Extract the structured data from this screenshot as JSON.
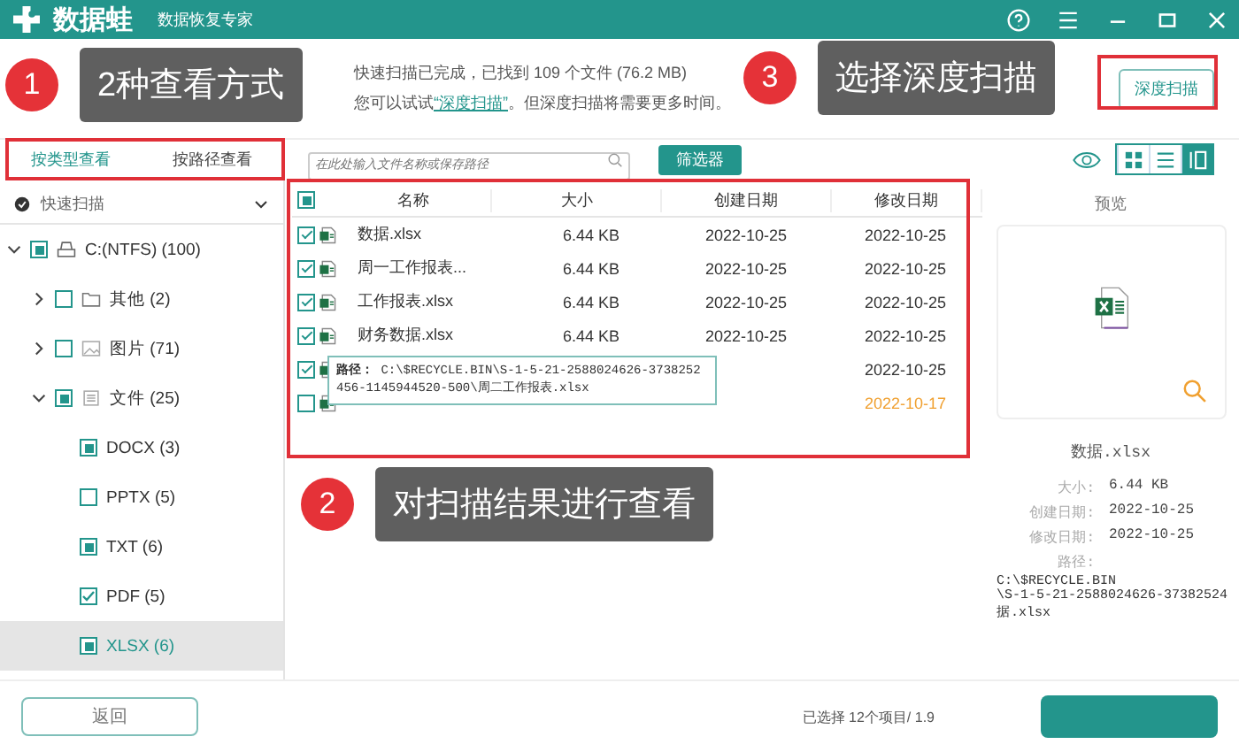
{
  "app": {
    "name": "数据蛙",
    "subtitle": "数据恢复专家"
  },
  "scan_info": {
    "line1": "快速扫描已完成，已找到 109 个文件 (76.2 MB)",
    "line2_before": "您可以试试",
    "link": "“深度扫描”",
    "line2_after": "。但深度扫描将需要更多时间。"
  },
  "deep_scan_button": "深度扫描",
  "view_tabs": [
    {
      "label": "按类型查看",
      "selected": true
    },
    {
      "label": "按路径查看",
      "selected": false
    }
  ],
  "search": {
    "placeholder": "在此处输入文件名称或保存路径"
  },
  "filter_button": "筛选器",
  "view_modes": [
    {
      "kind": "grid",
      "selected": false
    },
    {
      "kind": "list",
      "selected": false
    },
    {
      "kind": "detail",
      "selected": true
    }
  ],
  "scan_select": "快速扫描",
  "tree": [
    {
      "label": "C:(NTFS) (100)",
      "kind": "drive",
      "partial": true,
      "checked": false,
      "expanded": true,
      "selected": false,
      "children": [
        {
          "label": "其他 (2)",
          "kind": "folder",
          "partial": false,
          "checked": false,
          "expanded": false,
          "selected": false
        },
        {
          "label": "图片 (71)",
          "kind": "image",
          "partial": false,
          "checked": false,
          "expanded": false,
          "selected": false
        },
        {
          "label": "文件 (25)",
          "kind": "doc",
          "partial": true,
          "checked": false,
          "expanded": true,
          "selected": false,
          "children": [
            {
              "label": "DOCX (3)",
              "partial": true,
              "checked": false,
              "selected": false
            },
            {
              "label": "PPTX (5)",
              "partial": false,
              "checked": false,
              "selected": false
            },
            {
              "label": "TXT (6)",
              "partial": true,
              "checked": false,
              "selected": false
            },
            {
              "label": "PDF (5)",
              "partial": false,
              "checked": true,
              "selected": false
            },
            {
              "label": "XLSX (6)",
              "partial": true,
              "checked": false,
              "selected": true
            }
          ]
        }
      ]
    }
  ],
  "table": {
    "columns": [
      "名称",
      "大小",
      "创建日期",
      "修改日期"
    ],
    "header_partial": true,
    "rows": [
      {
        "checked": true,
        "name": "数据.xlsx",
        "size": "6.44 KB",
        "created": "2022-10-25",
        "modified": "2022-10-25",
        "recent": false
      },
      {
        "checked": true,
        "name": "周一工作报表...",
        "size": "6.44 KB",
        "created": "2022-10-25",
        "modified": "2022-10-25",
        "recent": false
      },
      {
        "checked": true,
        "name": "工作报表.xlsx",
        "size": "6.44 KB",
        "created": "2022-10-25",
        "modified": "2022-10-25",
        "recent": false
      },
      {
        "checked": true,
        "name": "财务数据.xlsx",
        "size": "6.44 KB",
        "created": "2022-10-25",
        "modified": "2022-10-25",
        "recent": false
      },
      {
        "checked": true,
        "modified": "2022-10-25",
        "recent": false
      },
      {
        "checked": false,
        "modified": "2022-10-17",
        "recent": true
      }
    ]
  },
  "tooltip": {
    "label": "路径：",
    "path": "C:\\$RECYCLE.BIN\\S-1-5-21-2588024626-3738252456-1145944520-500\\周二工作报表.xlsx"
  },
  "preview": {
    "title": "预览",
    "file_name": "数据.xlsx",
    "fields": [
      {
        "label": "大小:",
        "value": "6.44 KB"
      },
      {
        "label": "创建日期:",
        "value": "2022-10-25"
      },
      {
        "label": "修改日期:",
        "value": "2022-10-25"
      },
      {
        "label": "路径:"
      }
    ],
    "path_lines": [
      "C:\\$RECYCLE.BIN",
      "\\S-1-5-21-2588024626-37382524",
      "据.xlsx"
    ]
  },
  "footer": {
    "back_button": "返回",
    "status": "已选择 12个项目/ 1.9"
  },
  "annotations": [
    {
      "number": "1",
      "text": "2种查看方式"
    },
    {
      "number": "2",
      "text": "对扫描结果进行查看"
    },
    {
      "number": "3",
      "text": "选择深度扫描"
    }
  ]
}
